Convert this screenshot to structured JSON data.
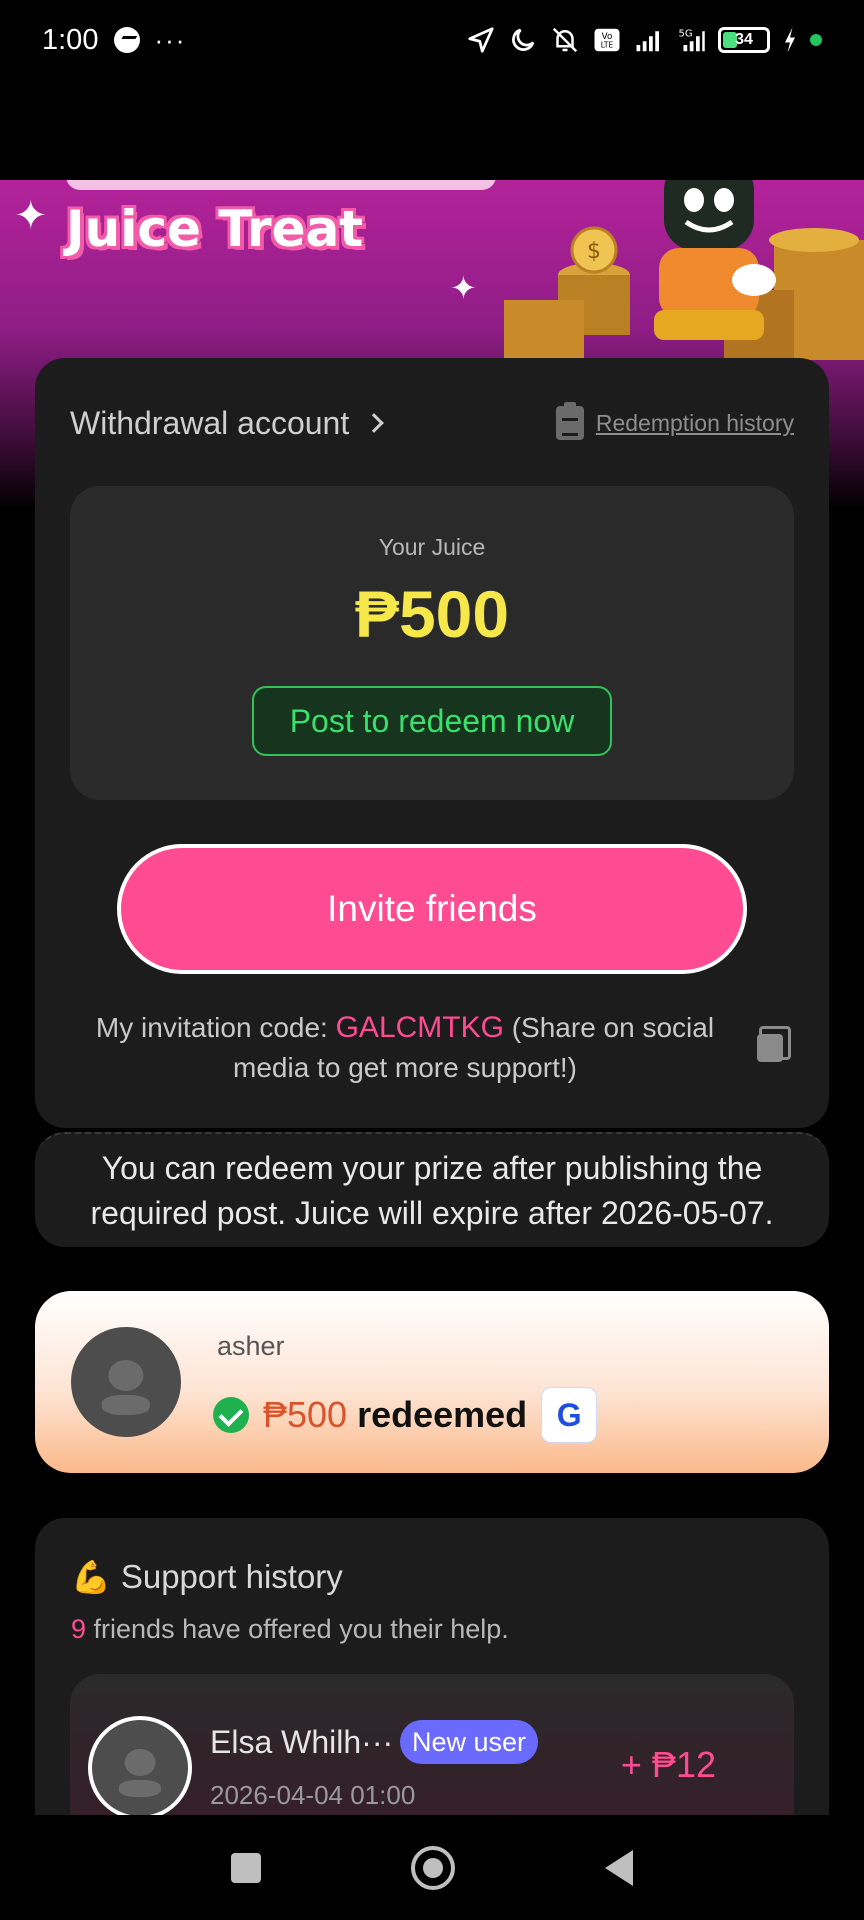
{
  "status_bar": {
    "time": "1:00",
    "battery": "34"
  },
  "banner": {
    "title": "Juice Treat"
  },
  "main": {
    "withdrawal_label": "Withdrawal account",
    "redemption_history_label": "Redemption history",
    "juice_label": "Your Juice",
    "juice_amount": "₱500",
    "post_redeem_label": "Post to redeem now",
    "invite_label": "Invite friends",
    "invitation_prefix": "My invitation code: ",
    "invitation_code": "GALCMTKG",
    "invitation_suffix": " (Share on social media to get more support!)"
  },
  "notice": {
    "text": "You can redeem your prize after publishing the required post. Juice will expire after 2026-05-07."
  },
  "redeemed": {
    "username": "asher",
    "amount": "₱500",
    "status_text": "redeemed",
    "wallet_icon": "G"
  },
  "support_history": {
    "title": "Support history",
    "count": "9",
    "subtitle_text": " friends have offered you their help.",
    "friends": [
      {
        "name": "Elsa Whilh···",
        "badge": "New user",
        "date": "2026-04-04 01:00",
        "amount": "+ ₱12"
      }
    ]
  },
  "icons": {
    "messenger": "messenger-icon",
    "location": "location-arrow-icon",
    "moon": "moon-icon",
    "mute": "bell-off-icon",
    "clipboard": "clipboard-icon",
    "copy": "copy-icon",
    "check": "check-circle-icon"
  },
  "colors": {
    "accent_pink": "#ff4b92",
    "juice_yellow": "#f6e84a",
    "success_green": "#39e06a",
    "badge_purple": "#6a6aff"
  }
}
